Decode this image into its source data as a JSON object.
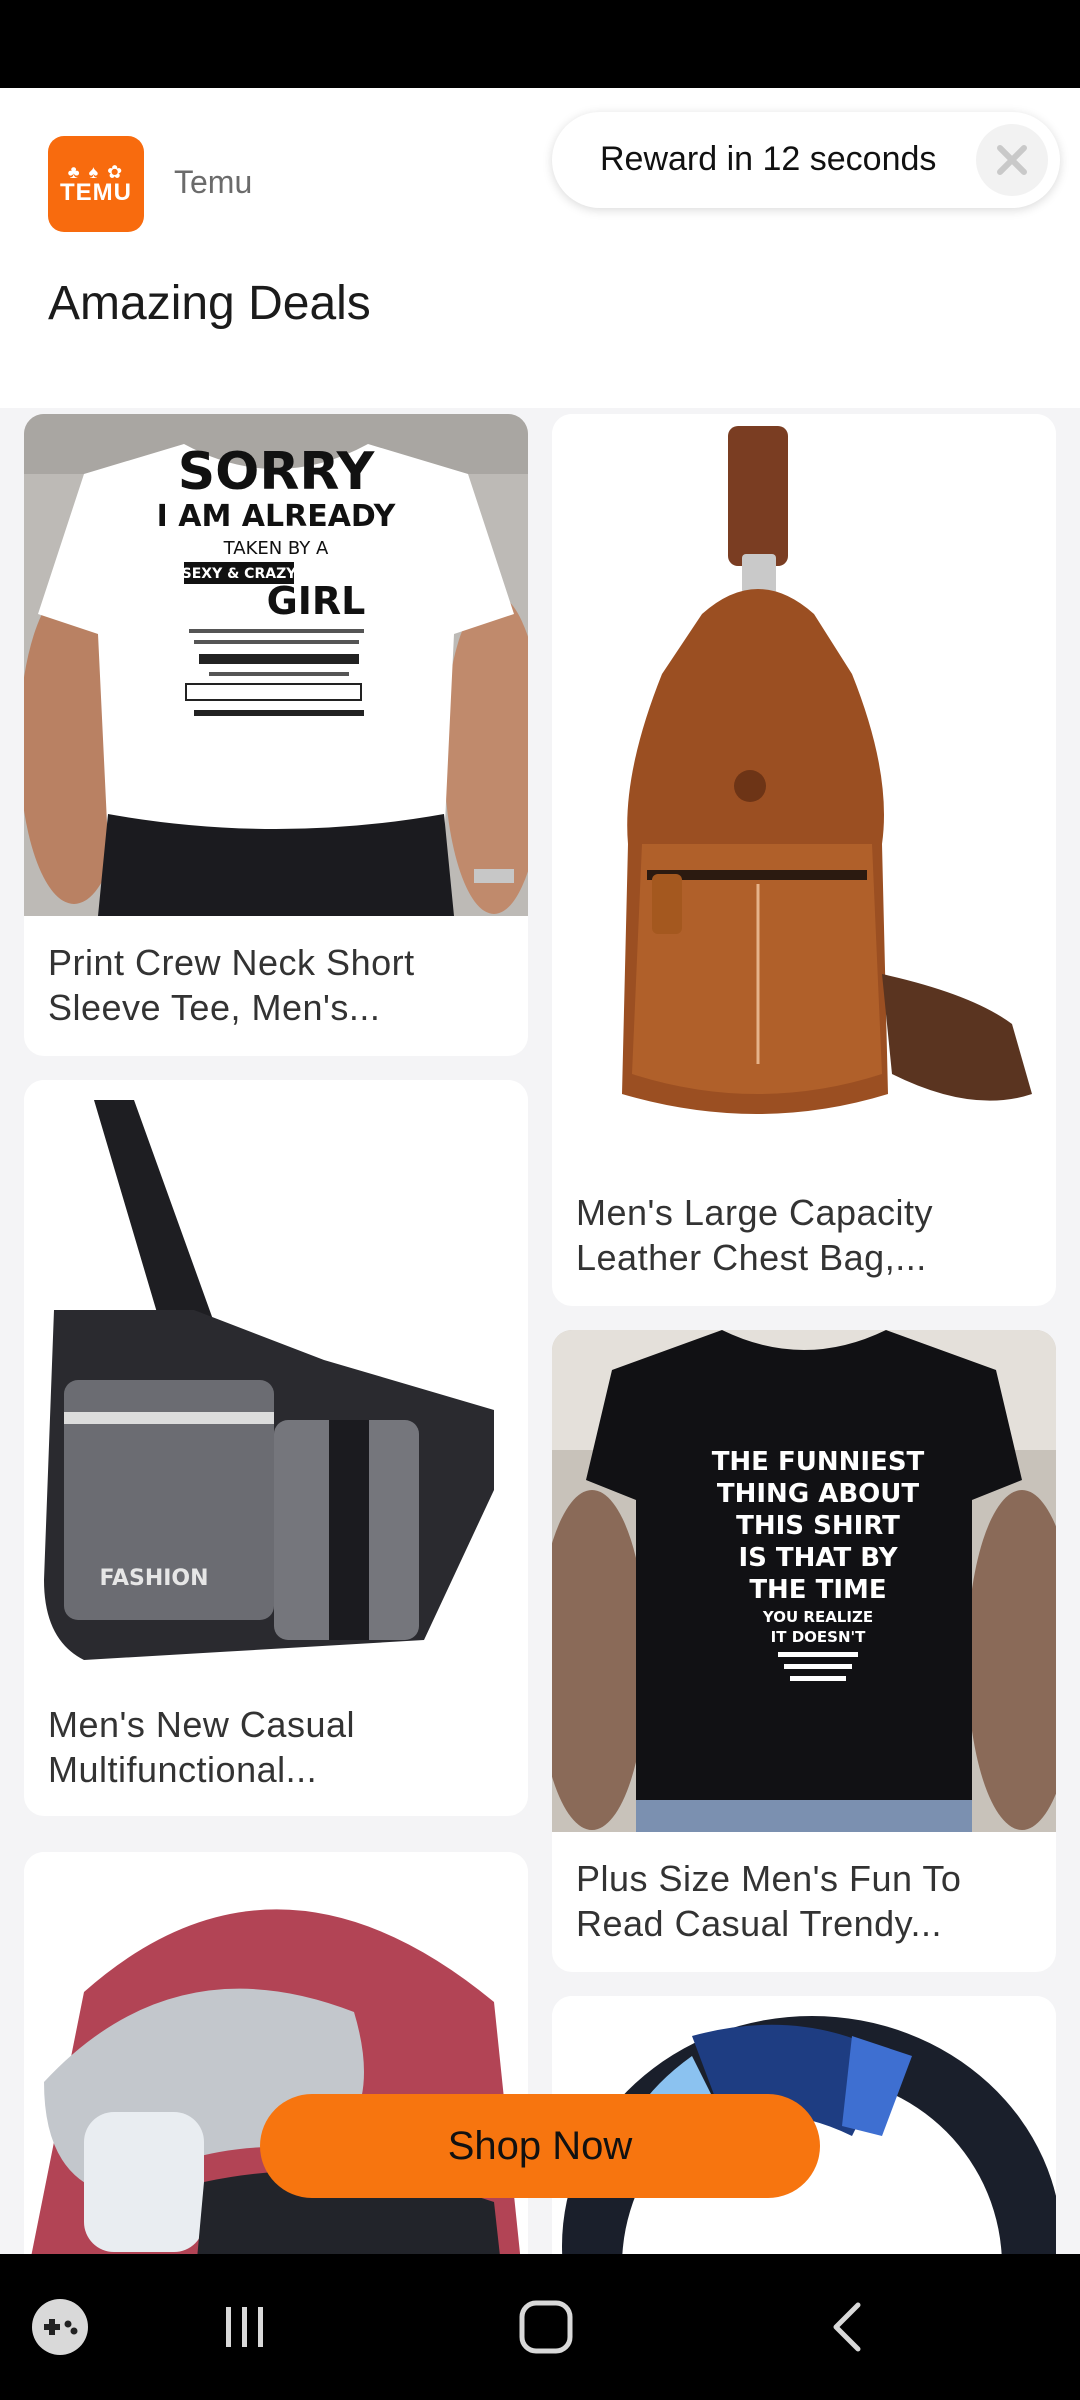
{
  "ad": {
    "brand_logo_text": "TEMU",
    "brand_name": "Temu",
    "headline": "Amazing Deals",
    "reward_timer": "Reward in 12 seconds",
    "cta_label": "Shop Now"
  },
  "products": [
    {
      "title": "Print Crew Neck Short Sleeve Tee, Men's...",
      "shirt_text": [
        "SORRY",
        "I AM ALREADY",
        "TAKEN BY A",
        "SEXY & CRAZY",
        "GIRL"
      ]
    },
    {
      "title": "Men's Large Capacity Leather Chest Bag,..."
    },
    {
      "title": "Men's New Casual Multifunctional...",
      "bag_text": "FASHION"
    },
    {
      "title": "Plus Size Men's Fun To Read Casual Trendy...",
      "shirt_text": [
        "THE FUNNIEST",
        "THING ABOUT",
        "THIS SHIRT",
        "IS THAT BY",
        "THE TIME",
        "YOU REALIZE",
        "IT DOESN'T"
      ]
    }
  ],
  "colors": {
    "brand_orange": "#f86b0e",
    "cta_orange": "#f7750f",
    "adchoices_blue": "#1e9fd8"
  }
}
